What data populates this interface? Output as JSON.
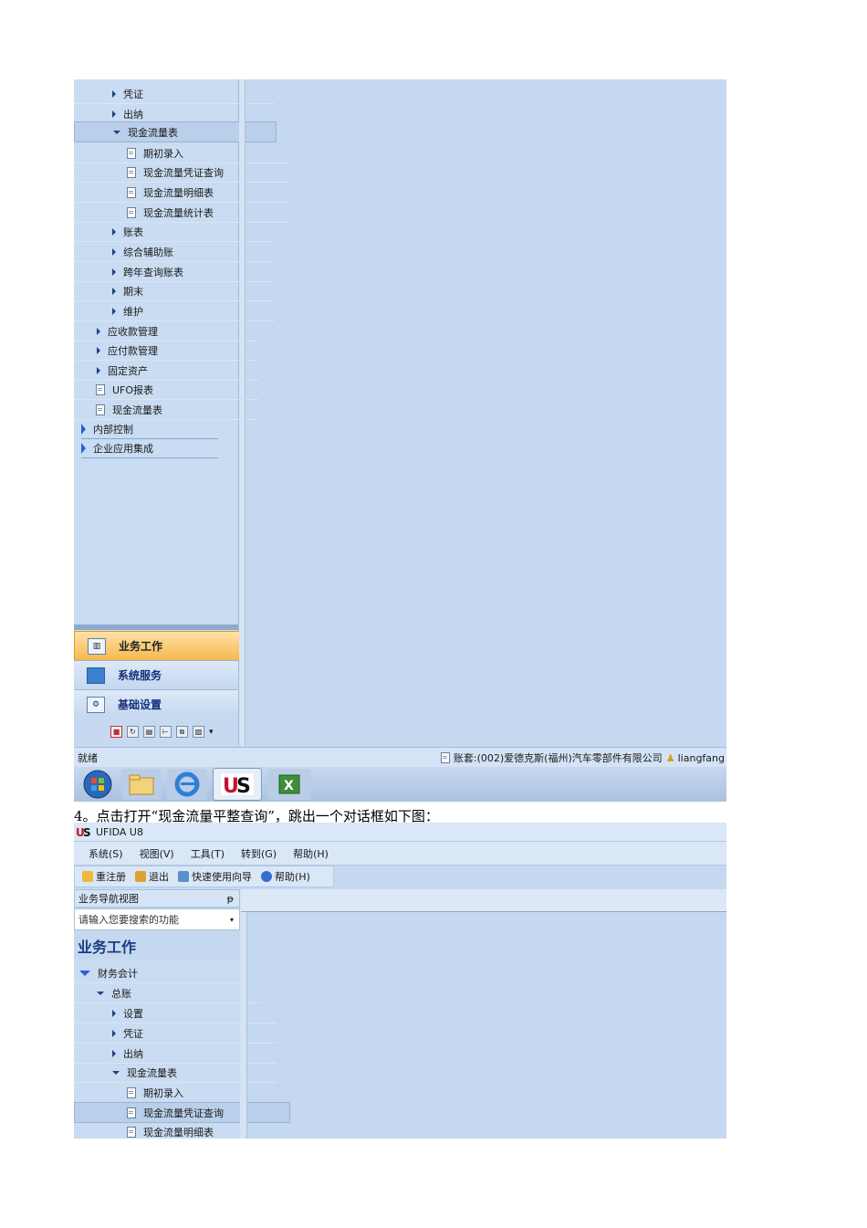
{
  "top_window": {
    "nav_items": [
      {
        "label": "凭证",
        "kind": "folder-collapsed"
      },
      {
        "label": "出纳",
        "kind": "folder-collapsed"
      },
      {
        "label": "现金流量表",
        "kind": "folder-expanded"
      },
      {
        "label": "期初录入",
        "kind": "doc"
      },
      {
        "label": "现金流量凭证查询",
        "kind": "doc"
      },
      {
        "label": "现金流量明细表",
        "kind": "doc"
      },
      {
        "label": "现金流量统计表",
        "kind": "doc"
      },
      {
        "label": "账表",
        "kind": "folder-collapsed"
      },
      {
        "label": "综合辅助账",
        "kind": "folder-collapsed"
      },
      {
        "label": "跨年查询账表",
        "kind": "folder-collapsed"
      },
      {
        "label": "期末",
        "kind": "folder-collapsed"
      },
      {
        "label": "维护",
        "kind": "folder-collapsed"
      },
      {
        "label": "应收款管理",
        "kind": "folder-collapsed"
      },
      {
        "label": "应付款管理",
        "kind": "folder-collapsed"
      },
      {
        "label": "固定资产",
        "kind": "folder-collapsed"
      },
      {
        "label": "UFO报表",
        "kind": "doc"
      },
      {
        "label": "现金流量表",
        "kind": "doc"
      },
      {
        "label": "内部控制",
        "kind": "group-collapsed"
      },
      {
        "label": "企业应用集成",
        "kind": "group-collapsed"
      }
    ],
    "panels": {
      "business": "业务工作",
      "system": "系统服务",
      "basic": "基础设置"
    },
    "status": {
      "left": "就绪",
      "account": "账套:(002)爱德克斯(福州)汽车零部件有限公司",
      "user": "liangfang"
    }
  },
  "caption": "4。点击打开“现金流量平整查询”，跳出一个对话框如下图：",
  "bottom_window": {
    "app_title": "UFIDA U8",
    "menu": [
      "系统(S)",
      "视图(V)",
      "工具(T)",
      "转到(G)",
      "帮助(H)"
    ],
    "toolbar": {
      "relogin": "重注册",
      "exit": "退出",
      "wizard": "快速使用向导",
      "help": "帮助(H)"
    },
    "nav_header": "业务导航视图",
    "pin": "ᵽ",
    "search_placeholder": "请输入您要搜索的功能",
    "nav_title": "业务工作",
    "nav_items": [
      {
        "label": "财务会计"
      },
      {
        "label": "总账"
      },
      {
        "label": "设置"
      },
      {
        "label": "凭证"
      },
      {
        "label": "出纳"
      },
      {
        "label": "现金流量表"
      },
      {
        "label": "期初录入"
      },
      {
        "label": "现金流量凭证查询"
      },
      {
        "label": "现金流量明细表"
      }
    ]
  },
  "colors": {
    "accent_orange": "#f7b84e",
    "nav_blue": "#c9dcf2",
    "content_blue": "#c4d9f0"
  }
}
